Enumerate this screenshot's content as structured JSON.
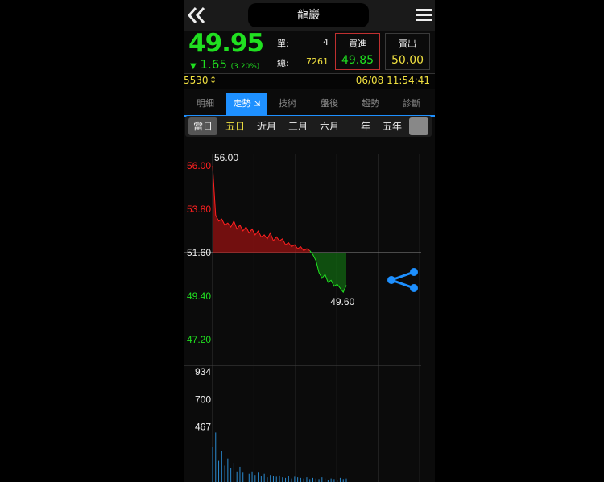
{
  "header": {
    "title": "龍巖",
    "back_icon": "double-chevron-left-icon",
    "menu_icon": "hamburger-menu-icon"
  },
  "quote": {
    "price": "49.95",
    "change_arrow": "▼",
    "change": "1.65",
    "change_pct": "(3.20%)",
    "single_label": "單:",
    "single_value": "4",
    "total_label": "總:",
    "total_value": "7261",
    "buy_label": "買進",
    "buy_value": "49.85",
    "sell_label": "賣出",
    "sell_value": "50.00"
  },
  "info": {
    "code": "5530",
    "updown_icon": "↕",
    "datetime": "06/08 11:54:41"
  },
  "tabs": [
    "明細",
    "走勢",
    "技術",
    "盤後",
    "趨勢",
    "診斷"
  ],
  "active_tab": "走勢",
  "ranges": [
    "當日",
    "五日",
    "近月",
    "三月",
    "六月",
    "一年",
    "五年"
  ],
  "colors": {
    "up": "#ff2020",
    "down": "#20e020",
    "accent": "#1e90ff",
    "yellow": "#f0e040"
  },
  "chart_data": [
    {
      "type": "area",
      "y_ticks": [
        "56.00",
        "53.80",
        "51.60",
        "49.40",
        "47.20"
      ],
      "ylim": [
        47.2,
        56.0
      ],
      "reference": 51.6,
      "high_label": "56.00",
      "low_label": "49.60",
      "series": [
        {
          "values": [
            56.0,
            53.5,
            53.2,
            53.3,
            53.0,
            53.1,
            52.9,
            53.2,
            52.8,
            53.0,
            52.7,
            52.9,
            52.6,
            52.8,
            52.5,
            52.7,
            52.4,
            52.5,
            52.3,
            52.6,
            52.2,
            52.4,
            52.2,
            52.3,
            52.0,
            52.1,
            51.9,
            52.0,
            51.8,
            51.9,
            51.7,
            51.8,
            51.7,
            51.5,
            51.2,
            50.6,
            50.3,
            50.5,
            50.1,
            50.2,
            49.9,
            50.0,
            49.8,
            49.6,
            49.95
          ]
        }
      ]
    },
    {
      "type": "bar",
      "y_ticks": [
        "934",
        "700",
        "467"
      ],
      "ylim": [
        0,
        934
      ],
      "values": [
        300,
        420,
        180,
        260,
        140,
        200,
        120,
        160,
        90,
        130,
        80,
        100,
        70,
        90,
        60,
        80,
        50,
        70,
        40,
        60,
        50,
        45,
        55,
        40,
        35,
        50,
        30,
        45,
        40,
        35,
        30,
        40,
        25,
        35,
        30,
        25,
        40,
        30,
        20,
        30,
        25,
        20,
        35,
        25,
        30
      ]
    }
  ]
}
